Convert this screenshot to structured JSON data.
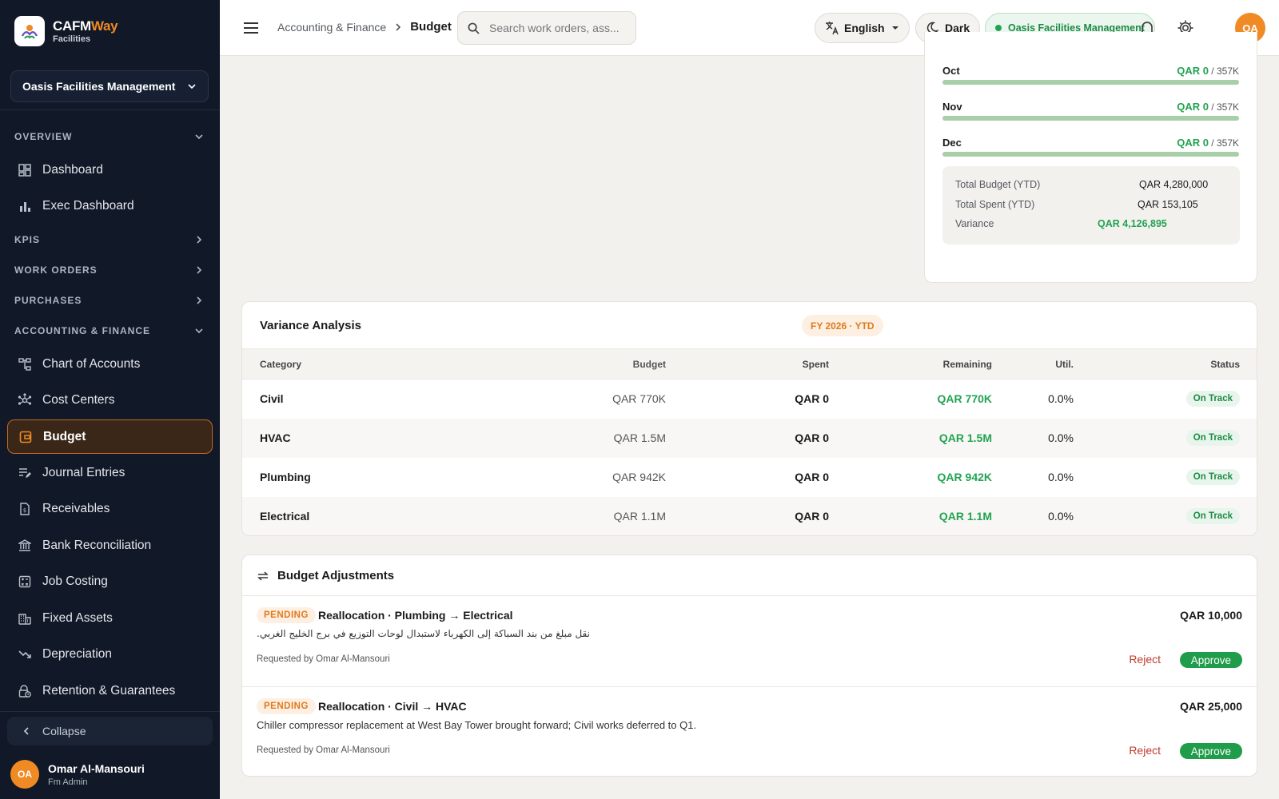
{
  "brand": {
    "name_part1": "CAFM",
    "name_part2": "Way",
    "sub": "Facilities"
  },
  "org_select": {
    "label": "Oasis Facilities Management"
  },
  "sidebar": {
    "sections": [
      {
        "label": "OVERVIEW",
        "items": [
          {
            "label": "Dashboard"
          },
          {
            "label": "Exec Dashboard"
          }
        ]
      },
      {
        "label": "KPIS"
      },
      {
        "label": "WORK ORDERS"
      },
      {
        "label": "PURCHASES"
      },
      {
        "label": "ACCOUNTING & FINANCE",
        "items": [
          {
            "label": "Chart of Accounts"
          },
          {
            "label": "Cost Centers"
          },
          {
            "label": "Budget"
          },
          {
            "label": "Journal Entries"
          },
          {
            "label": "Receivables"
          },
          {
            "label": "Bank Reconciliation"
          },
          {
            "label": "Job Costing"
          },
          {
            "label": "Fixed Assets"
          },
          {
            "label": "Depreciation"
          },
          {
            "label": "Retention & Guarantees"
          }
        ]
      }
    ],
    "collapse_label": "Collapse",
    "user": {
      "initials": "OA",
      "name": "Omar Al-Mansouri",
      "role": "Fm Admin"
    }
  },
  "topbar": {
    "breadcrumb": {
      "parent": "Accounting & Finance",
      "current": "Budget"
    },
    "search_placeholder": "Search work orders, ass...",
    "language": "English",
    "theme": "Dark",
    "org": "Oasis Facilities Management",
    "avatar_initials": "OA"
  },
  "monthly": [
    {
      "month": "Oct",
      "spent": "QAR 0",
      "budget": "/ 357K",
      "utilization": 0.0
    },
    {
      "month": "Nov",
      "spent": "QAR 0",
      "budget": "/ 357K",
      "utilization": 0.0
    },
    {
      "month": "Dec",
      "spent": "QAR 0",
      "budget": "/ 357K",
      "utilization": 0.0
    }
  ],
  "totals": {
    "budget_label": "Total Budget (YTD)",
    "budget_value": "QAR 4,280,000",
    "spent_label": "Total Spent (YTD)",
    "spent_value": "QAR 153,105",
    "variance_label": "Variance",
    "variance_value": "QAR 4,126,895"
  },
  "variance": {
    "title": "Variance Analysis",
    "badge": "FY 2026 · YTD",
    "columns": [
      "Category",
      "Budget",
      "Spent",
      "Remaining",
      "Util.",
      "Status"
    ],
    "rows": [
      {
        "category": "Civil",
        "budget": "QAR 770K",
        "spent": "QAR 0",
        "remaining": "QAR 770K",
        "util": "0.0%",
        "status": "On Track"
      },
      {
        "category": "HVAC",
        "budget": "QAR 1.5M",
        "spent": "QAR 0",
        "remaining": "QAR 1.5M",
        "util": "0.0%",
        "status": "On Track"
      },
      {
        "category": "Plumbing",
        "budget": "QAR 942K",
        "spent": "QAR 0",
        "remaining": "QAR 942K",
        "util": "0.0%",
        "status": "On Track"
      },
      {
        "category": "Electrical",
        "budget": "QAR 1.1M",
        "spent": "QAR 0",
        "remaining": "QAR 1.1M",
        "util": "0.0%",
        "status": "On Track"
      }
    ]
  },
  "adjustments": {
    "title": "Budget Adjustments",
    "items": [
      {
        "status": "PENDING",
        "title": "Reallocation · Plumbing → Electrical",
        "amount": "QAR 10,000",
        "description": "نقل مبلغ من بند السباكة إلى الكهرباء لاستبدال لوحات التوزيع في برج الخليج الغربي.",
        "requested": "Requested by Omar Al-Mansouri",
        "reject": "Reject",
        "approve": "Approve"
      },
      {
        "status": "PENDING",
        "title": "Reallocation · Civil → HVAC",
        "amount": "QAR 25,000",
        "description": "Chiller compressor replacement at West Bay Tower brought forward; Civil works deferred to Q1.",
        "requested": "Requested by Omar Al-Mansouri",
        "reject": "Reject",
        "approve": "Approve"
      }
    ]
  }
}
